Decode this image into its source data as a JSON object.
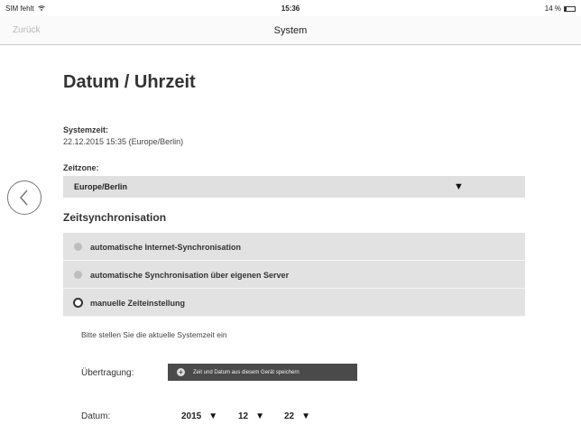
{
  "status_bar": {
    "carrier": "SIM fehlt",
    "time": "15:36",
    "battery": "14 %"
  },
  "nav": {
    "back_label": "Zurück",
    "title": "System"
  },
  "page": {
    "title": "Datum / Uhrzeit"
  },
  "system_time": {
    "label": "Systemzeit:",
    "value": "22.12.2015 15:35 (Europe/Berlin)"
  },
  "timezone": {
    "label": "Zeitzone:",
    "selected": "Europe/Berlin"
  },
  "sync": {
    "title": "Zeitsynchronisation",
    "options": [
      {
        "label": "automatische Internet-Synchronisation",
        "state": "disabled"
      },
      {
        "label": "automatische Synchronisation über eigenen Server",
        "state": "disabled"
      },
      {
        "label": "manuelle Zeiteinstellung",
        "state": "selected"
      }
    ]
  },
  "manual": {
    "hint": "Bitte stellen Sie die aktuelle Systemzeit ein",
    "transfer_label": "Übertragung:",
    "save_button": "Zeit und Datum aus diesem Gerät speichern",
    "date_label": "Datum:",
    "year": "2015",
    "month": "12",
    "day": "22"
  },
  "icons": [
    "wifi-icon",
    "battery-icon",
    "back-chevron-icon",
    "dropdown-arrow-icon",
    "radio-icon",
    "plus-circle-icon"
  ]
}
